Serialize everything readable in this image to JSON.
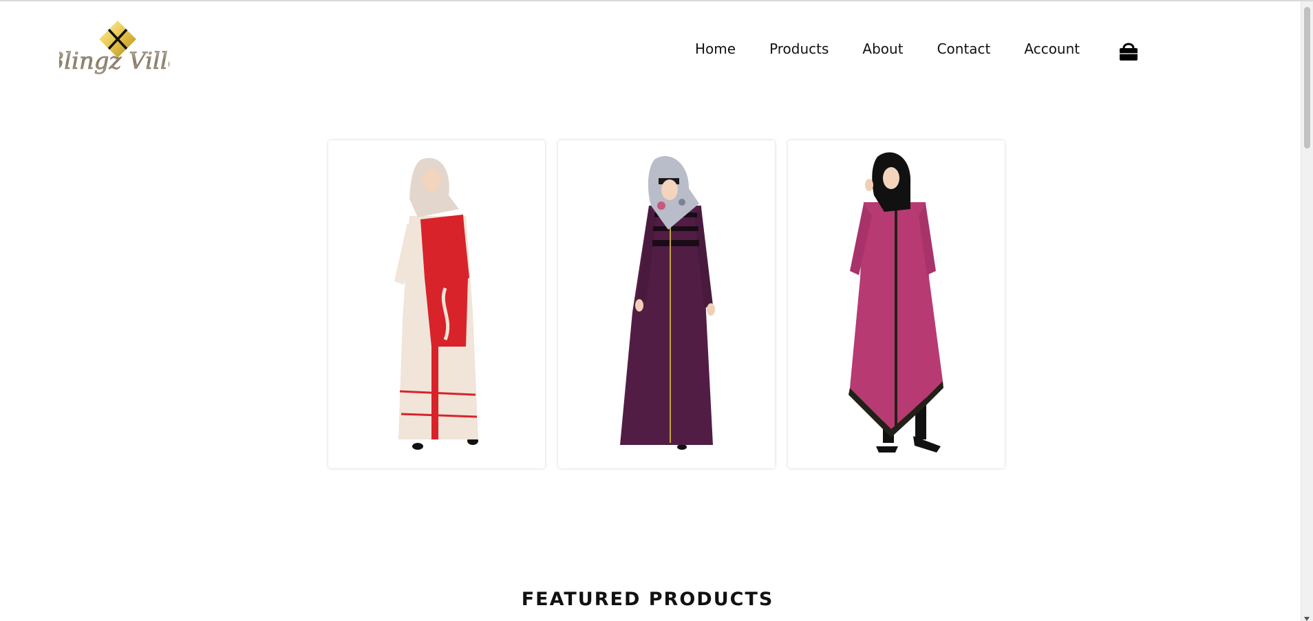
{
  "brand": {
    "logo_text": "Blingz Ville",
    "logo_icon": "diamond-x-emblem",
    "gold_color": "#e6c44a"
  },
  "nav": {
    "items": [
      {
        "label": "Home"
      },
      {
        "label": "Products"
      },
      {
        "label": "About"
      },
      {
        "label": "Contact"
      },
      {
        "label": "Account"
      }
    ],
    "cart_icon": "shopping-bag-icon"
  },
  "products": [
    {
      "name": "red-cream-abaya",
      "dress_color": "#d8232a",
      "secondary_color": "#f1e4d8",
      "hijab_color": "#e3d6cc"
    },
    {
      "name": "purple-abaya",
      "dress_color": "#521d45",
      "secondary_color": "#1a0c16",
      "hijab_color": "#b9bcc9"
    },
    {
      "name": "pink-tunic",
      "dress_color": "#b83a72",
      "secondary_color": "#222018",
      "hijab_color": "#111111"
    }
  ],
  "sections": {
    "featured_title": "FEATURED PRODUCTS"
  }
}
